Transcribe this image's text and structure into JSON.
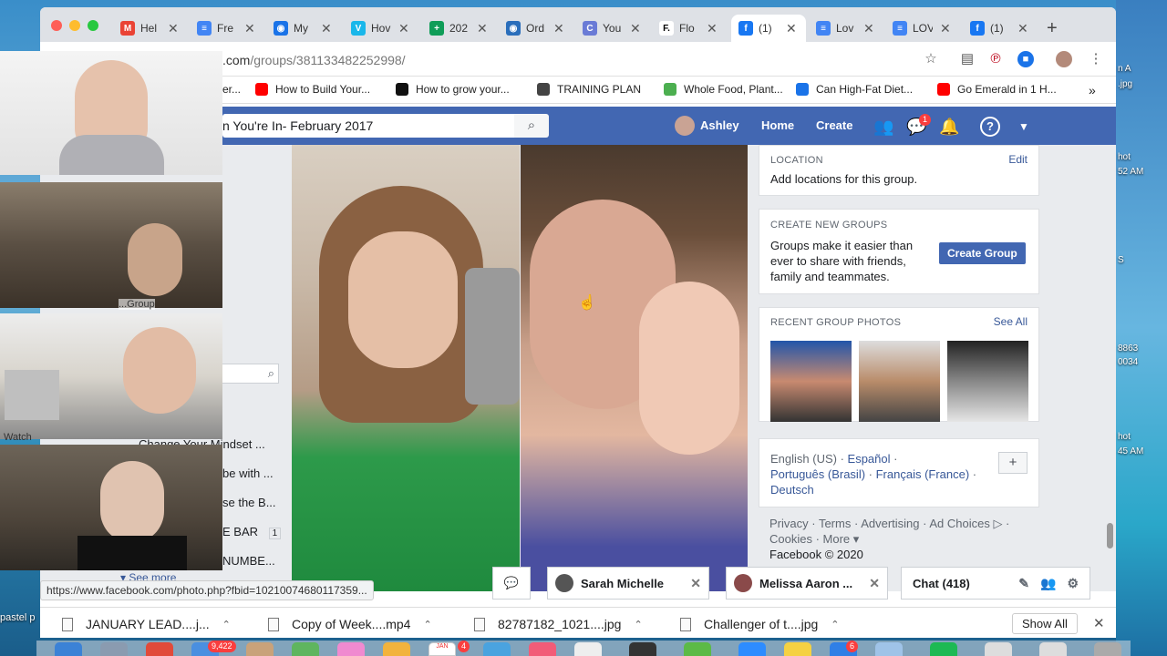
{
  "browser": {
    "tabs": [
      {
        "label": "Hel",
        "color": "#ea4335",
        "glyph": "M"
      },
      {
        "label": "Fre",
        "color": "#4285f4",
        "glyph": "≡"
      },
      {
        "label": "My",
        "color": "#1a73e8",
        "glyph": "◉"
      },
      {
        "label": "Hov",
        "color": "#1ab7ea",
        "glyph": "V"
      },
      {
        "label": "202",
        "color": "#0f9d58",
        "glyph": "+"
      },
      {
        "label": "Ord",
        "color": "#2a6ebb",
        "glyph": "◉"
      },
      {
        "label": "You",
        "color": "#6a7bd6",
        "glyph": "C"
      },
      {
        "label": "Flo",
        "color": "#ffffff",
        "glyph": "F."
      },
      {
        "label": "(1)",
        "color": "#1877f2",
        "glyph": "f",
        "active": true
      },
      {
        "label": "Lov",
        "color": "#4285f4",
        "glyph": "≡"
      },
      {
        "label": "LOV",
        "color": "#4285f4",
        "glyph": "≡"
      },
      {
        "label": "(1)",
        "color": "#1877f2",
        "glyph": "f"
      }
    ],
    "url_prefix": ".com",
    "url_path": "/groups/381133482252998/",
    "bookmarks": [
      {
        "label": "er...",
        "color": "#333"
      },
      {
        "label": "How to Build Your...",
        "color": "#ff0000"
      },
      {
        "label": "How to grow your...",
        "color": "#111111"
      },
      {
        "label": "TRAINING PLAN",
        "color": "#444444"
      },
      {
        "label": "Whole Food, Plant...",
        "color": "#4caf50"
      },
      {
        "label": "Can High-Fat Diet...",
        "color": "#1a73e8"
      },
      {
        "label": "Go Emerald in 1 H...",
        "color": "#ff0000"
      }
    ],
    "more_bookmarks": "»"
  },
  "facebook": {
    "search_value": "n You're In- February 2017",
    "user_name": "Ashley",
    "nav_home": "Home",
    "nav_create": "Create",
    "messages_badge": "1",
    "location": {
      "caption": "LOCATION",
      "edit": "Edit",
      "text": "Add locations for this group."
    },
    "create_groups": {
      "caption": "CREATE NEW GROUPS",
      "text": "Groups make it easier than ever to share with friends, family and teammates.",
      "button": "Create Group"
    },
    "recent_photos": {
      "caption": "RECENT GROUP PHOTOS",
      "see_all": "See All"
    },
    "languages": {
      "current": "English (US)",
      "options": [
        "Español",
        "Português (Brasil)",
        "Français (France)",
        "Deutsch"
      ],
      "sep": " · ",
      "add": "+"
    },
    "footer": {
      "links": [
        "Privacy",
        "Terms",
        "Advertising",
        "Ad Choices",
        "Cookies",
        "More"
      ],
      "copyright": "Facebook © 2020"
    },
    "left_list": [
      {
        "text": "Change Your Mindset ..."
      },
      {
        "text": "be with ..."
      },
      {
        "text": "se the B..."
      },
      {
        "text": "E BAR",
        "count": "1"
      },
      {
        "text": "NUMBE..."
      }
    ],
    "left_see_more": "See more",
    "left_group_fragment": "...Group"
  },
  "chat": {
    "tab1": "Sarah Michelle",
    "tab2": "Melissa Aaron ...",
    "main": "Chat (418)"
  },
  "status_url": "https://www.facebook.com/photo.php?fbid=10210074680117359...",
  "downloads": {
    "items": [
      "JANUARY LEAD....j...",
      "Copy of Week....mp4",
      "82787182_1021....jpg",
      "Challenger of t....jpg"
    ],
    "show_all": "Show All"
  },
  "desktop": {
    "file_labels": [
      "n A",
      ".jpg",
      "hot",
      "52 AM",
      "S",
      "8863",
      "0034",
      "hot",
      "45 AM"
    ],
    "pastel_fragment": "pastel p",
    "watch_fragment": "Watch"
  },
  "dock": {
    "badge_mail": "9,422",
    "badge_cal": "4",
    "cal_month": "JAN",
    "badge_other": "6"
  }
}
